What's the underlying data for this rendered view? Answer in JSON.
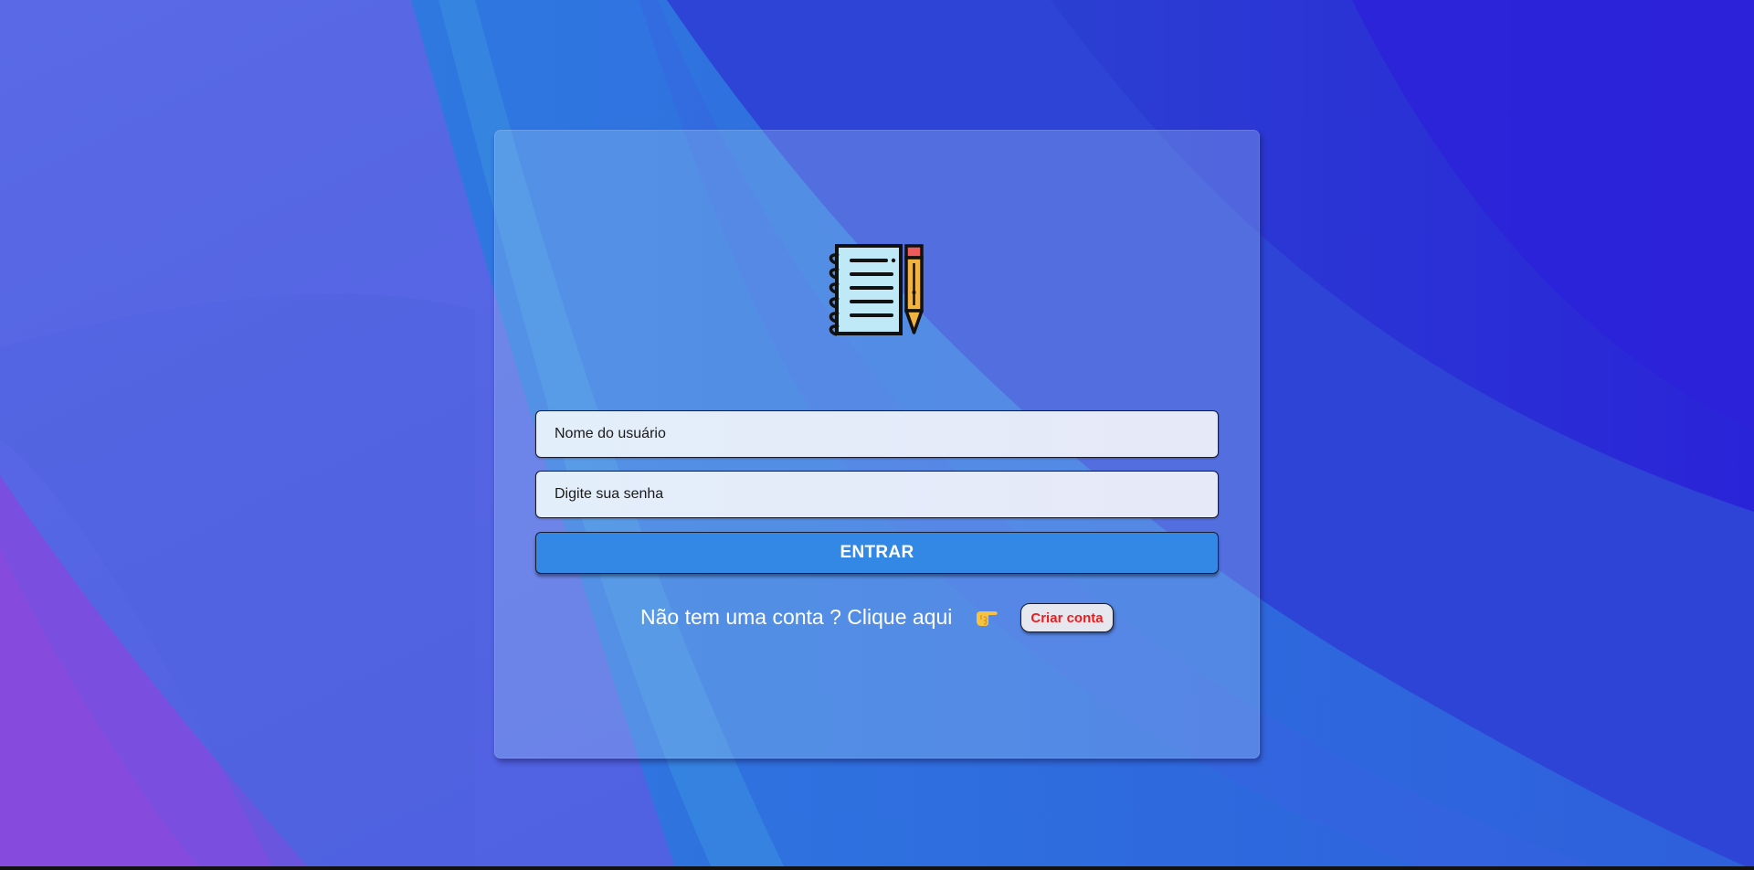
{
  "login": {
    "username_placeholder": "Nome do usuário",
    "password_placeholder": "Digite sua senha",
    "enter_label": "ENTRAR",
    "signup_prompt": "Não tem uma conta ? Clique aqui",
    "create_account_label": "Criar conta"
  },
  "icons": {
    "logo": "notebook-pencil-icon",
    "pointer": "pointing-hand-icon"
  },
  "colors": {
    "enter_button": "#3388e6",
    "create_account_text": "#e81e1e",
    "background_primary": "#3b4fe0"
  }
}
